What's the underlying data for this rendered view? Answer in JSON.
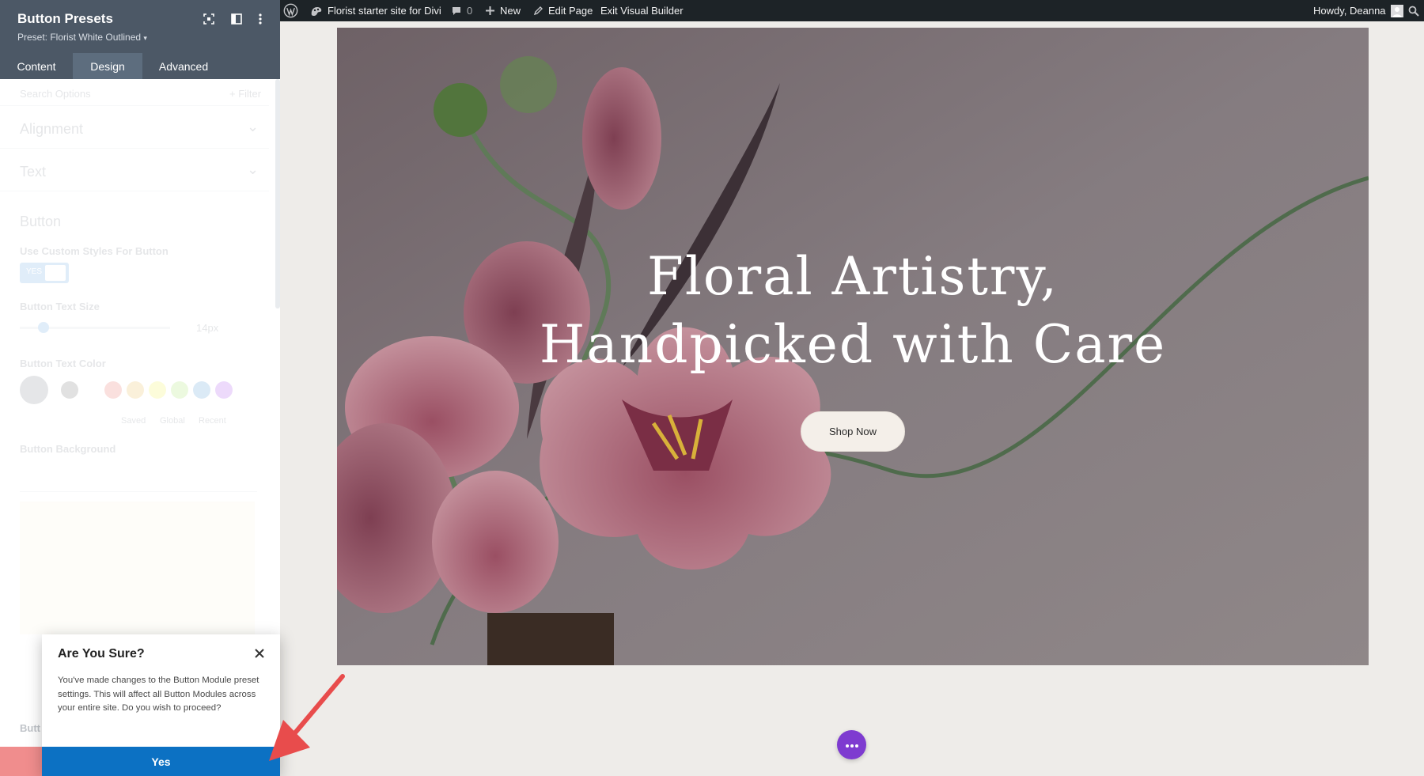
{
  "admin_bar": {
    "site_name": "Florist starter site for Divi",
    "comments_count": "0",
    "new_label": "New",
    "edit_page_label": "Edit Page",
    "exit_builder_label": "Exit Visual Builder",
    "howdy_label": "Howdy, Deanna"
  },
  "panel": {
    "title": "Button Presets",
    "preset_label": "Preset: Florist White Outlined",
    "tabs": [
      {
        "label": "Content"
      },
      {
        "label": "Design",
        "active": true
      },
      {
        "label": "Advanced"
      }
    ],
    "faded": {
      "search_placeholder": "Search Options",
      "filter_label": "+ Filter",
      "sections": [
        "Alignment",
        "Text",
        "Button"
      ],
      "use_custom_styles_label": "Use Custom Styles For Button",
      "toggle_value": "YES",
      "text_size_label": "Button Text Size",
      "text_size_value": "14px",
      "text_color_label": "Button Text Color",
      "color_tabs": [
        "Saved",
        "Global",
        "Recent"
      ],
      "background_label": "Button Background",
      "border_label_partial": "Butt"
    }
  },
  "modal": {
    "title": "Are You Sure?",
    "message": "You've made changes to the Button Module preset settings. This will affect all Button Modules across your entire site. Do you wish to proceed?",
    "confirm_label": "Yes"
  },
  "hero": {
    "title_line1": "Floral Artistry,",
    "title_line2": "Handpicked with Care",
    "button_label": "Shop Now"
  },
  "colors": {
    "admin_bar": "#1d2327",
    "panel_header": "#4c5866",
    "active_tab": "#5d6d7e",
    "confirm_button": "#0c71c3",
    "fab": "#7e3bd0",
    "arrow": "#e84c4c",
    "page_background": "#eeece9"
  },
  "icons": {
    "wordpress": "wordpress-logo-icon",
    "customize": "paint-palette-icon",
    "comments": "comment-bubble-icon",
    "new": "plus-icon",
    "edit": "pencil-icon",
    "avatar": "user-avatar-icon",
    "search": "search-icon",
    "focus": "fullscreen-icon",
    "layout": "split-view-icon",
    "more": "kebab-menu-icon",
    "close": "close-icon",
    "fab": "ellipsis-icon"
  }
}
